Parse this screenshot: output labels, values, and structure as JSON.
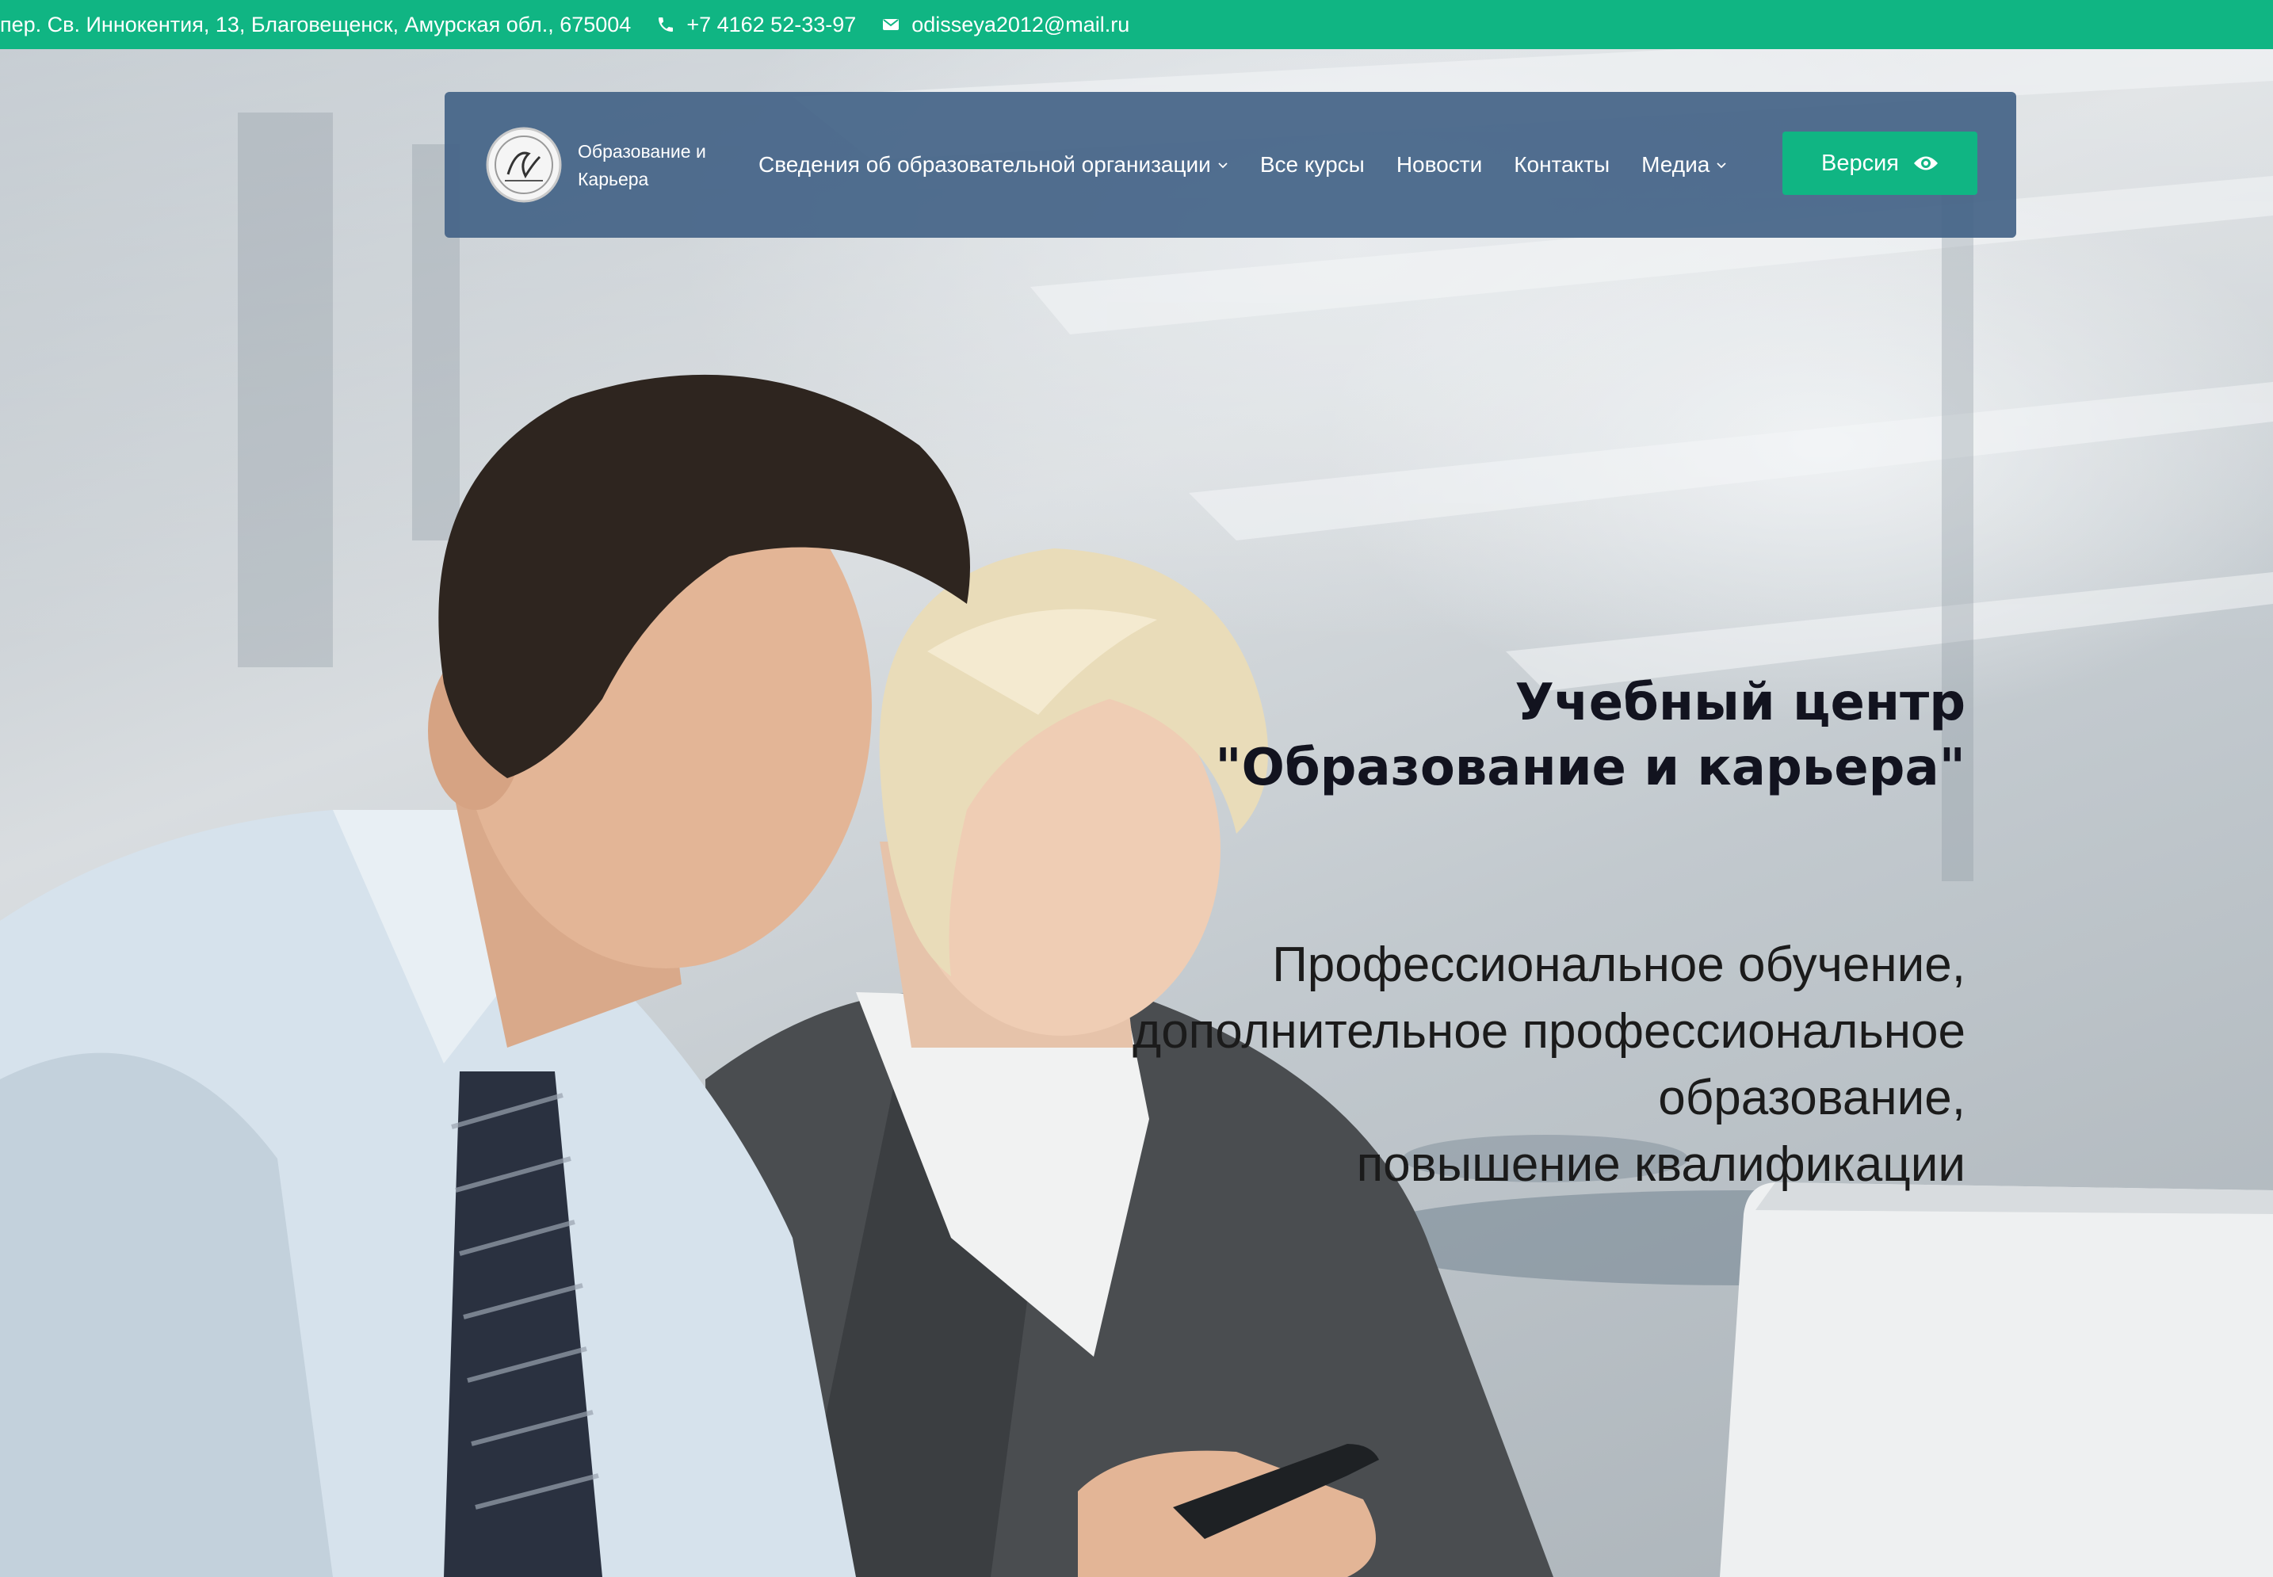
{
  "topbar": {
    "address": "пер. Св. Иннокентия, 13, Благовещенск, Амурская обл., 675004",
    "phone": "+7 4162 52-33-97",
    "email": "odisseya2012@mail.ru",
    "phone_icon": "phone-icon",
    "email_icon": "envelope-icon"
  },
  "nav": {
    "brand_line1": "Образование и",
    "brand_line2": "Карьера",
    "items": [
      {
        "label": "Сведения об образовательной организации",
        "has_dropdown": true
      },
      {
        "label": "Все курсы",
        "has_dropdown": false
      },
      {
        "label": "Новости",
        "has_dropdown": false
      },
      {
        "label": "Контакты",
        "has_dropdown": false
      },
      {
        "label": "Медиа",
        "has_dropdown": true
      }
    ],
    "version_button": "Версия",
    "version_icon": "eye-icon"
  },
  "hero": {
    "title_line1": "Учебный центр",
    "title_line2": "\"Образование и карьера\"",
    "subtitle_line1": "Профессиональное обучение,",
    "subtitle_line2": "дополнительное профессиональное",
    "subtitle_line3": "образование,",
    "subtitle_line4": "повышение квалификации"
  },
  "colors": {
    "accent_green": "#10b583",
    "nav_background": "#436387",
    "title_text": "#12131f"
  }
}
